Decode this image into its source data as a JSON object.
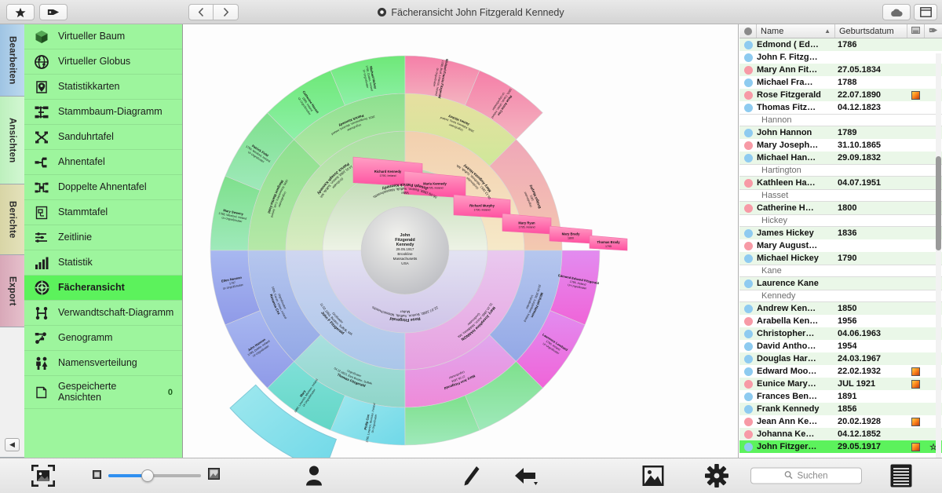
{
  "titlebar": {
    "title": "Fächeransicht John Fitzgerald Kennedy",
    "star_icon": "star-icon",
    "tag_icon": "tag-icon",
    "back_icon": "chevron-left-icon",
    "forward_icon": "chevron-right-icon",
    "cloud_icon": "cloud-icon",
    "panel_icon": "panel-toggle-icon"
  },
  "vertical_tabs": [
    {
      "label": "Bearbeiten",
      "color": "#9fc4e3"
    },
    {
      "label": "Ansichten",
      "color": "#bdf0bd"
    },
    {
      "label": "Berichte",
      "color": "#d8d5a6"
    },
    {
      "label": "Export",
      "color": "#d8a8b8"
    }
  ],
  "collapse_label": "◀",
  "sidebar": {
    "items": [
      {
        "label": "Virtueller Baum",
        "icon": "cube-icon",
        "selected": false
      },
      {
        "label": "Virtueller Globus",
        "icon": "globe-icon",
        "selected": false
      },
      {
        "label": "Statistikkarten",
        "icon": "map-pin-icon",
        "selected": false
      },
      {
        "label": "Stammbaum-Diagramm",
        "icon": "tree-icon",
        "selected": false
      },
      {
        "label": "Sanduhrtafel",
        "icon": "hourglass-icon",
        "selected": false
      },
      {
        "label": "Ahnentafel",
        "icon": "ancestor-icon",
        "selected": false
      },
      {
        "label": "Doppelte Ahnentafel",
        "icon": "double-ancestor-icon",
        "selected": false
      },
      {
        "label": "Stammtafel",
        "icon": "document-icon",
        "selected": false
      },
      {
        "label": "Zeitlinie",
        "icon": "timeline-icon",
        "selected": false
      },
      {
        "label": "Statistik",
        "icon": "bar-chart-icon",
        "selected": false
      },
      {
        "label": "Fächeransicht",
        "icon": "fan-icon",
        "selected": true
      },
      {
        "label": "Verwandtschaft-Diagramm",
        "icon": "relation-icon",
        "selected": false
      },
      {
        "label": "Genogramm",
        "icon": "genogram-icon",
        "selected": false
      },
      {
        "label": "Namensverteilung",
        "icon": "people-icon",
        "selected": false
      },
      {
        "label": "Gespeicherte Ansichten",
        "icon": "saved-icon",
        "selected": false,
        "badge": "0"
      }
    ]
  },
  "fan_chart": {
    "center": {
      "name": "John Fitzgerald Kennedy",
      "detail": "29.05.1917, Brookline, Massachusetts, USA"
    },
    "ring1": [
      {
        "name": "Joseph Patrick Kennedy",
        "detail": "06.09.1888, Boston, Suffolk, Massachusetts",
        "relation": "Vater"
      },
      {
        "name": "Rose Fitzgerald",
        "detail": "22.07.1890, Boston, Suffolk, Massachusetts",
        "relation": "Mutter"
      }
    ],
    "ring2": [
      {
        "name": "Patrick Joseph Kennedy",
        "detail": "14.01.1858, Boston, Suffolk, MA",
        "relation": "Großvater"
      },
      {
        "name": "Mary Augusta Hickey",
        "detail": "06.12.1857, Winthrop, Suffolk, MA",
        "relation": "Großmutter"
      },
      {
        "name": "John F Fitzgerald",
        "detail": "11.02.1863, Boston, Suffolk, MA",
        "relation": "Großvater"
      },
      {
        "name": "Mary Josephine HANNON",
        "detail": "31.10.1865, Acton, Middlesex, MA",
        "relation": "Großmutter"
      }
    ],
    "ring3": [
      {
        "name": "Margaret Martha Field",
        "detail": "1836, Rosscarbery, Cork, Ireland",
        "relation": "Urgroßmutter"
      },
      {
        "name": "Patrick Kennedy",
        "detail": "1823, Dunganstown, Wexford, Ireland",
        "relation": "Urgroßvater"
      },
      {
        "name": "James Hickey",
        "detail": "1836, Killarney, Kerry, Ireland",
        "relation": "Urgroßvater"
      },
      {
        "name": "Bridget Murphy",
        "detail": "1821",
        "relation": "Urgroßmutter"
      },
      {
        "name": "Thomas Fitzgerald",
        "detail": "04.12.1823, East Boston, Suffolk",
        "relation": "Urgroßvater"
      },
      {
        "name": "Rosanna Cox",
        "detail": "1835, Cavan, Ulster, Ireland",
        "relation": "Urgroßmutter"
      },
      {
        "name": "Michael Hannon",
        "detail": "29.09.1832, Lurgankeel, Ireland",
        "relation": "Urgroßvater"
      },
      {
        "name": "Mary Ann Fitzgerald",
        "detail": "27.05.1834",
        "relation": "Urgroßmutter"
      }
    ],
    "ring4": [
      {
        "name": "Mary Sweeny",
        "detail": "1788, Wexford, Ireland",
        "relation": "Ur-Urgroßmutter"
      },
      {
        "name": "Patrick Field",
        "detail": "1790, Wexford, Ireland",
        "relation": "Ur-Urgroßvater"
      },
      {
        "name": "Catherine Hasset",
        "detail": "1800, Ireland",
        "relation": "Ur-Urgroßmutter"
      },
      {
        "name": "Michael Hickey",
        "detail": "1790, Dublin, Ireland",
        "relation": "Ur-Urgroßvater"
      },
      {
        "name": "Michael Francis Fitzgerald",
        "detail": "1788, Bruff, Limerick, Ireland",
        "relation": "Ur-Urgroßvater"
      },
      {
        "name": "Rose Anna Cox",
        "detail": "1800, Cavan, Ulster, Ireland",
        "relation": "Ur-Urgroßmutter"
      },
      {
        "name": "Philip Cox",
        "detail": "1795, Limerick, Munster, Ireland",
        "relation": "Ur-Urgroßvater"
      },
      {
        "name": "Mary",
        "detail": "1800, Limerick, Munster, Ireland",
        "relation": "Ur-Urgroßmutter"
      },
      {
        "name": "John Hannon",
        "detail": "1789, Dublin, Ireland",
        "relation": "Ur-Urgroßvater"
      },
      {
        "name": "Ellen Noonan",
        "detail": "1797",
        "relation": "Ur-Urgroßmutter"
      },
      {
        "name": "Edmond Edward Fitzgerald",
        "detail": "1786, Ireland",
        "relation": "Ur-Urgroßvater"
      },
      {
        "name": "Lawrence Lombard",
        "detail": "1790, Ireland",
        "relation": "Ur-Urgroßvater"
      }
    ],
    "right_strips": [
      {
        "name": "Richard Kennedy",
        "detail": "1790, Ireland",
        "relation": "Ur-Urgroßvater"
      },
      {
        "name": "Maria Kennedy",
        "detail": "1795, Ireland",
        "relation": "Ur-Urgroßmutter"
      },
      {
        "name": "Richard Murphy",
        "detail": "1790, Ireland"
      },
      {
        "name": "Mary Ryan",
        "detail": "1795, Ireland"
      },
      {
        "name": "Mary Brady",
        "detail": "1800"
      },
      {
        "name": "Thomas Brady",
        "detail": "1795"
      }
    ]
  },
  "right_panel": {
    "columns": {
      "name": "Name",
      "date": "Geburtsdatum"
    },
    "sort_caret": "︿",
    "rows": [
      {
        "type": "person",
        "sex": "m",
        "name": "Edmond ( Ed…",
        "date": "1786"
      },
      {
        "type": "person",
        "sex": "m",
        "name": "John F. Fitzg…",
        "date": ""
      },
      {
        "type": "person",
        "sex": "f",
        "name": "Mary Ann Fit…",
        "date": "27.05.1834"
      },
      {
        "type": "person",
        "sex": "m",
        "name": "Michael Fra…",
        "date": "1788"
      },
      {
        "type": "person",
        "sex": "f",
        "name": "Rose Fitzgerald",
        "date": "22.07.1890",
        "thumb": true
      },
      {
        "type": "person",
        "sex": "m",
        "name": "Thomas Fitz…",
        "date": "04.12.1823"
      },
      {
        "type": "group",
        "name": "Hannon"
      },
      {
        "type": "person",
        "sex": "m",
        "name": "John Hannon",
        "date": "1789"
      },
      {
        "type": "person",
        "sex": "f",
        "name": "Mary Joseph…",
        "date": "31.10.1865"
      },
      {
        "type": "person",
        "sex": "m",
        "name": "Michael Han…",
        "date": "29.09.1832"
      },
      {
        "type": "group",
        "name": "Hartington"
      },
      {
        "type": "person",
        "sex": "f",
        "name": "Kathleen Ha…",
        "date": "04.07.1951"
      },
      {
        "type": "group",
        "name": "Hasset"
      },
      {
        "type": "person",
        "sex": "f",
        "name": "Catherine H…",
        "date": "1800"
      },
      {
        "type": "group",
        "name": "Hickey"
      },
      {
        "type": "person",
        "sex": "m",
        "name": "James Hickey",
        "date": "1836"
      },
      {
        "type": "person",
        "sex": "f",
        "name": "Mary August…",
        "date": ""
      },
      {
        "type": "person",
        "sex": "m",
        "name": "Michael Hickey",
        "date": "1790"
      },
      {
        "type": "group",
        "name": "Kane"
      },
      {
        "type": "person",
        "sex": "m",
        "name": "Laurence Kane",
        "date": ""
      },
      {
        "type": "group",
        "name": "Kennedy"
      },
      {
        "type": "person",
        "sex": "m",
        "name": "Andrew Ken…",
        "date": "1850"
      },
      {
        "type": "person",
        "sex": "f",
        "name": "Arabella Ken…",
        "date": "1956"
      },
      {
        "type": "person",
        "sex": "m",
        "name": "Christopher…",
        "date": "04.06.1963"
      },
      {
        "type": "person",
        "sex": "m",
        "name": "David Antho…",
        "date": "1954"
      },
      {
        "type": "person",
        "sex": "m",
        "name": "Douglas Har…",
        "date": "24.03.1967"
      },
      {
        "type": "person",
        "sex": "m",
        "name": "Edward Moo…",
        "date": "22.02.1932",
        "thumb": true
      },
      {
        "type": "person",
        "sex": "f",
        "name": "Eunice Mary…",
        "date": "JUL 1921",
        "thumb": true
      },
      {
        "type": "person",
        "sex": "m",
        "name": "Frances Ben…",
        "date": "1891"
      },
      {
        "type": "person",
        "sex": "m",
        "name": "Frank Kennedy",
        "date": "1856"
      },
      {
        "type": "person",
        "sex": "f",
        "name": "Jean Ann Ke…",
        "date": "20.02.1928",
        "thumb": true
      },
      {
        "type": "person",
        "sex": "f",
        "name": "Johanna Ke…",
        "date": "04.12.1852"
      },
      {
        "type": "person",
        "sex": "m",
        "name": "John Fitzger…",
        "date": "29.05.1917",
        "thumb": true,
        "star": true,
        "selected": true
      }
    ]
  },
  "bottom_toolbar": {
    "fit_icon": "fit-to-screen-icon",
    "zoom_small_icon": "zoom-out-thumbnail-icon",
    "zoom_large_icon": "zoom-in-thumbnail-icon",
    "zoom_value": 36,
    "person_icon": "person-icon",
    "edit_icon": "pencil-icon",
    "undo_icon": "undo-icon",
    "image_icon": "picture-icon",
    "settings_icon": "gear-icon",
    "list_icon": "list-view-icon",
    "search_icon": "search-icon",
    "search_placeholder": "Suchen",
    "search_value": ""
  },
  "colors": {
    "selection_green": "#5cf25c",
    "sidebar_green": "#9df59d",
    "male_dot": "#8ecbf0",
    "female_dot": "#f79aa6",
    "slider_blue": "#2f8ff0"
  }
}
